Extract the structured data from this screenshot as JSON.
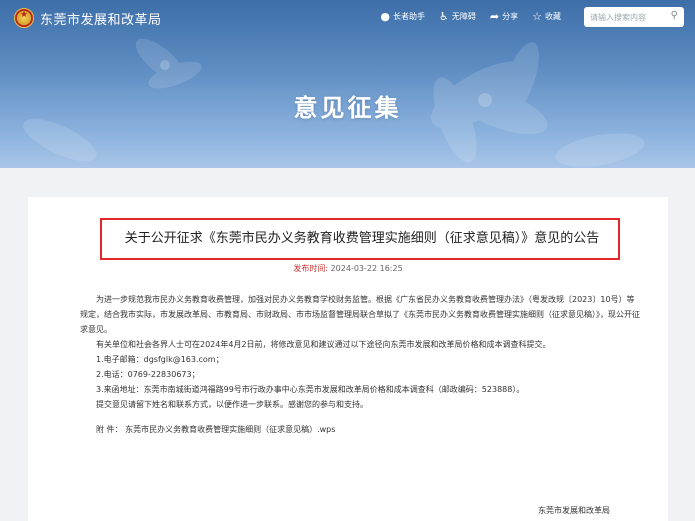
{
  "header": {
    "site_name": "东莞市发展和改革局",
    "tools": [
      {
        "label": "长者助手",
        "icon": "elder-icon"
      },
      {
        "label": "无障碍",
        "icon": "accessibility-icon"
      },
      {
        "label": "分享",
        "icon": "share-icon"
      },
      {
        "label": "收藏",
        "icon": "star-icon"
      }
    ],
    "search_placeholder": "请输入搜索内容",
    "banner_title": "意见征集"
  },
  "article": {
    "title": "关于公开征求《东莞市民办义务教育收费管理实施细则（征求意见稿）》意见的公告",
    "date_label": "发布时间:",
    "date_value": "2024-03-22 16:25",
    "para1": "为进一步规范我市民办义务教育收费管理，加强对民办义务教育学校财务监管。根据《广东省民办义务教育收费管理办法》（粤发改规〔2023〕10号）等规定，结合我市实际，市发展改革局、市教育局、市财政局、市市场监督管理局联合草拟了《东莞市民办义务教育收费管理实施细则（征求意见稿）》，现公开征求意见。",
    "para2": "有关单位和社会各界人士可在2024年4月2日前，将修改意见和建议通过以下途径向东莞市发展和改革局价格和成本调查科提交。",
    "email": "1.电子邮箱：dgsfglk@163.com；",
    "phone": "2.电话：0769-22830673；",
    "address": "3.来函地址：东莞市南城街道鸿福路99号市行政办事中心东莞市发展和改革局价格和成本调查科（邮政编码：523888）。",
    "closing": "提交意见请留下姓名和联系方式，以便作进一步联系。感谢您的参与和支持。",
    "attachment_label": "附  件：",
    "attachment_name": "东莞市民办义务教育收费管理实施细则（征求意见稿）.wps",
    "signature": "东莞市发展和改革局"
  },
  "colors": {
    "banner_top": "#3d6ea8",
    "title_border": "#e3262a",
    "date_label": "#cc3333"
  }
}
